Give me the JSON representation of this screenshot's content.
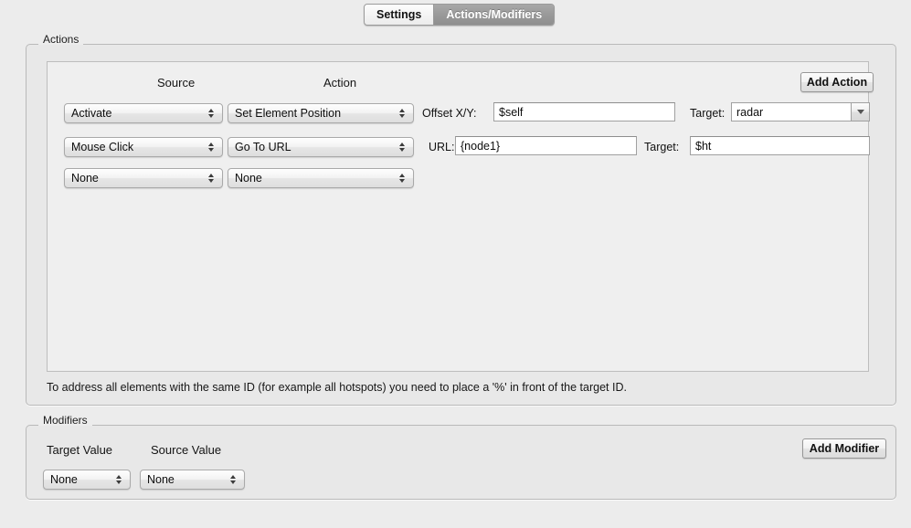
{
  "tabs": [
    {
      "label": "Settings",
      "active": true
    },
    {
      "label": "Actions/Modifiers",
      "active": false
    }
  ],
  "actions": {
    "group_label": "Actions",
    "columns": {
      "source": "Source",
      "action": "Action"
    },
    "add_button": "Add Action",
    "rows": [
      {
        "source": "Activate",
        "action": "Set Element Position",
        "param_label": "Offset X/Y:",
        "param_value": "$self",
        "target_label": "Target:",
        "target_value": "radar",
        "target_kind": "combobox"
      },
      {
        "source": "Mouse Click",
        "action": "Go To URL",
        "param_label": "URL:",
        "param_value": "{node1}",
        "target_label": "Target:",
        "target_value": "$ht",
        "target_kind": "textfield"
      },
      {
        "source": "None",
        "action": "None"
      }
    ],
    "help_text": "To address all elements with the same ID (for example all hotspots) you need to place a '%' in front of the target ID."
  },
  "modifiers": {
    "group_label": "Modifiers",
    "columns": {
      "target_value": "Target Value",
      "source_value": "Source Value"
    },
    "add_button": "Add Modifier",
    "rows": [
      {
        "target_value": "None",
        "source_value": "None"
      }
    ]
  },
  "colors": {
    "window_bg": "#ececec",
    "group_bg": "#e8e8e8",
    "panel_bg": "#efefef",
    "field_bg": "#ffffff",
    "border": "#b9b9b9",
    "tab_inactive_bg": "#9a9a9a",
    "text": "#1a1a1a"
  }
}
